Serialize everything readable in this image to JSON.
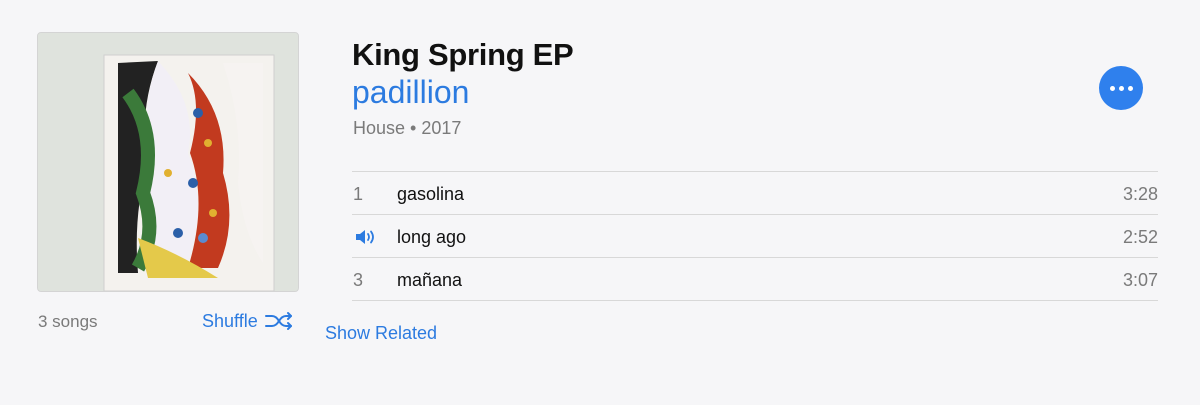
{
  "album": {
    "title": "King Spring EP",
    "artist": "padillion",
    "meta": "House • 2017",
    "song_count": "3 songs",
    "shuffle_label": "Shuffle",
    "show_related_label": "Show Related",
    "more_icon": "ellipsis-icon",
    "accent_color": "#2c7be0"
  },
  "tracks": [
    {
      "number": "1",
      "title": "gasolina",
      "duration": "3:28",
      "playing": false
    },
    {
      "number": "",
      "title": "long ago",
      "duration": "2:52",
      "playing": true,
      "icon": "speaker-icon"
    },
    {
      "number": "3",
      "title": "mañana",
      "duration": "3:07",
      "playing": false
    }
  ]
}
